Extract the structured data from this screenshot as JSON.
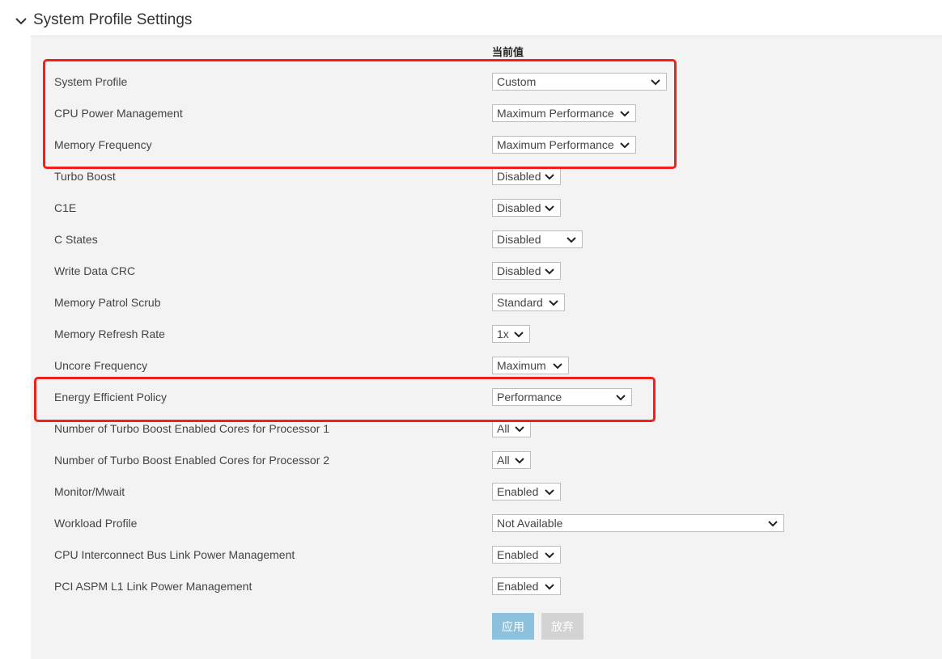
{
  "section": {
    "title": "System Profile Settings",
    "toggle_icon": "chevron-down-icon"
  },
  "column_header": "当前值",
  "rows": [
    {
      "label": "System Profile",
      "value": "Custom"
    },
    {
      "label": "CPU Power Management",
      "value": "Maximum Performance"
    },
    {
      "label": "Memory Frequency",
      "value": "Maximum Performance"
    },
    {
      "label": "Turbo Boost",
      "value": "Disabled"
    },
    {
      "label": "C1E",
      "value": "Disabled"
    },
    {
      "label": "C States",
      "value": "Disabled"
    },
    {
      "label": "Write Data CRC",
      "value": "Disabled"
    },
    {
      "label": "Memory Patrol Scrub",
      "value": "Standard"
    },
    {
      "label": "Memory Refresh Rate",
      "value": "1x"
    },
    {
      "label": "Uncore Frequency",
      "value": "Maximum"
    },
    {
      "label": "Energy Efficient Policy",
      "value": "Performance"
    },
    {
      "label": "Number of Turbo Boost Enabled Cores for Processor 1",
      "value": "All"
    },
    {
      "label": "Number of Turbo Boost Enabled Cores for Processor 2",
      "value": "All"
    },
    {
      "label": "Monitor/Mwait",
      "value": "Enabled"
    },
    {
      "label": "Workload Profile",
      "value": "Not Available"
    },
    {
      "label": "CPU Interconnect Bus Link Power Management",
      "value": "Enabled"
    },
    {
      "label": "PCI ASPM L1 Link Power Management",
      "value": "Enabled"
    }
  ],
  "buttons": {
    "apply": "应用",
    "discard": "放弃"
  },
  "colors": {
    "highlight": "#f0201a",
    "apply_button": "#8cc1de",
    "discard_button": "#d3d3d3",
    "panel_background": "#f3f3f3"
  }
}
